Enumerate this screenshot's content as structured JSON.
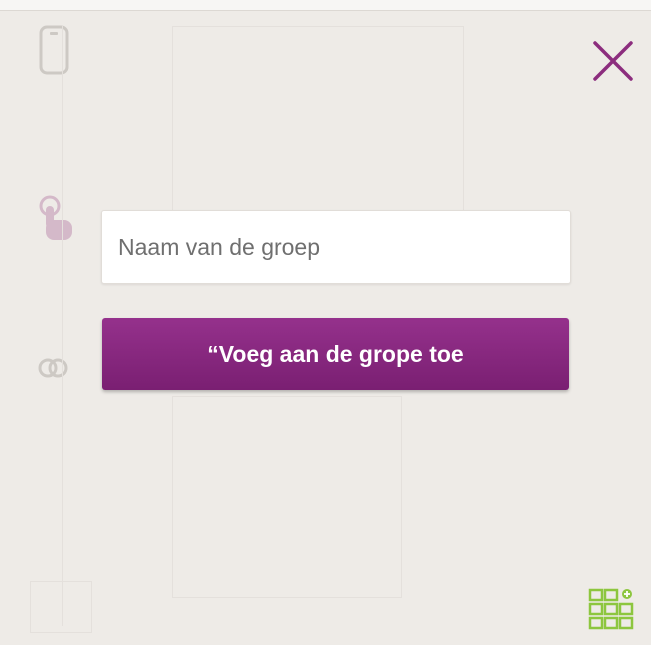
{
  "dialog": {
    "close_label": "close",
    "group_name_placeholder": "Naam van de groep",
    "group_name_value": "",
    "add_button_label": "“Voeg aan de grope toe"
  },
  "icons": {
    "close": "close-icon",
    "grid": "grid-icon",
    "phone": "phone-icon",
    "touch": "touch-icon",
    "link": "link-icon"
  },
  "colors": {
    "accent": "#8a2a82",
    "close_icon": "#8c2d7e",
    "grid_icon": "#8dc63f",
    "background": "#eeebe7"
  }
}
